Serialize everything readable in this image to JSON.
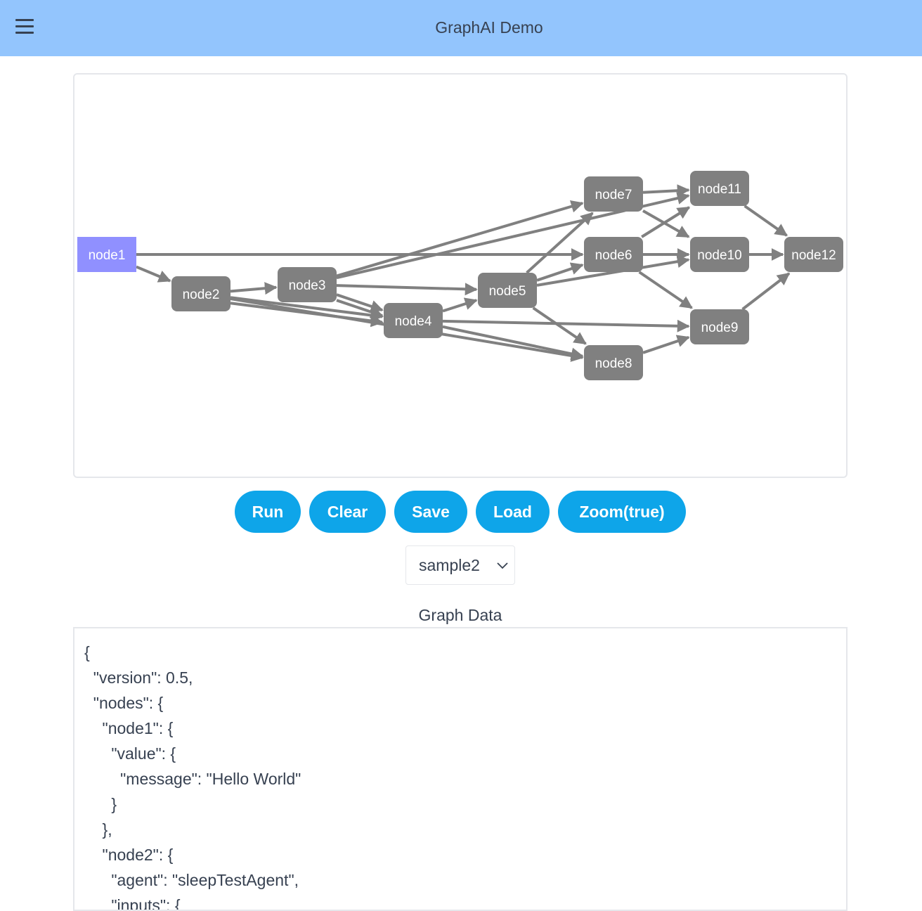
{
  "header": {
    "title": "GraphAI Demo",
    "menu_icon": "hamburger-menu-icon"
  },
  "graph": {
    "nodes": [
      {
        "id": "node1",
        "label": "node1",
        "state": "highlighted",
        "color": "#9090ff"
      },
      {
        "id": "node2",
        "label": "node2",
        "state": "default",
        "color": "#808080"
      },
      {
        "id": "node3",
        "label": "node3",
        "state": "default",
        "color": "#808080"
      },
      {
        "id": "node4",
        "label": "node4",
        "state": "default",
        "color": "#808080"
      },
      {
        "id": "node5",
        "label": "node5",
        "state": "default",
        "color": "#808080"
      },
      {
        "id": "node6",
        "label": "node6",
        "state": "default",
        "color": "#808080"
      },
      {
        "id": "node7",
        "label": "node7",
        "state": "default",
        "color": "#808080"
      },
      {
        "id": "node8",
        "label": "node8",
        "state": "default",
        "color": "#808080"
      },
      {
        "id": "node9",
        "label": "node9",
        "state": "default",
        "color": "#808080"
      },
      {
        "id": "node10",
        "label": "node10",
        "state": "default",
        "color": "#808080"
      },
      {
        "id": "node11",
        "label": "node11",
        "state": "default",
        "color": "#808080"
      },
      {
        "id": "node12",
        "label": "node12",
        "state": "default",
        "color": "#808080"
      }
    ],
    "edges": [
      [
        "node1",
        "node2"
      ],
      [
        "node1",
        "node6"
      ],
      [
        "node2",
        "node3"
      ],
      [
        "node2",
        "node4"
      ],
      [
        "node2",
        "node4"
      ],
      [
        "node2",
        "node8"
      ],
      [
        "node3",
        "node4"
      ],
      [
        "node3",
        "node4"
      ],
      [
        "node3",
        "node5"
      ],
      [
        "node3",
        "node7"
      ],
      [
        "node3",
        "node11"
      ],
      [
        "node4",
        "node5"
      ],
      [
        "node4",
        "node9"
      ],
      [
        "node4",
        "node8"
      ],
      [
        "node5",
        "node7"
      ],
      [
        "node5",
        "node6"
      ],
      [
        "node5",
        "node10"
      ],
      [
        "node5",
        "node8"
      ],
      [
        "node6",
        "node11"
      ],
      [
        "node6",
        "node10"
      ],
      [
        "node6",
        "node9"
      ],
      [
        "node7",
        "node11"
      ],
      [
        "node7",
        "node10"
      ],
      [
        "node8",
        "node9"
      ],
      [
        "node9",
        "node12"
      ],
      [
        "node10",
        "node12"
      ],
      [
        "node11",
        "node12"
      ]
    ],
    "edge_color": "#808080"
  },
  "controls": {
    "buttons": [
      {
        "id": "run",
        "label": "Run"
      },
      {
        "id": "clear",
        "label": "Clear"
      },
      {
        "id": "save",
        "label": "Save"
      },
      {
        "id": "load",
        "label": "Load"
      },
      {
        "id": "zoom",
        "label": "Zoom(true)"
      }
    ],
    "accent_color": "#0ea5e9",
    "sample_select": {
      "value": "sample2",
      "icon": "chevron-down-icon"
    }
  },
  "graph_data": {
    "title": "Graph Data",
    "lines": [
      "{",
      "  \"version\": 0.5,",
      "  \"nodes\": {",
      "    \"node1\": {",
      "      \"value\": {",
      "        \"message\": \"Hello World\"",
      "      }",
      "    },",
      "    \"node2\": {",
      "      \"agent\": \"sleepTestAgent\",",
      "      \"inputs\": {"
    ]
  }
}
